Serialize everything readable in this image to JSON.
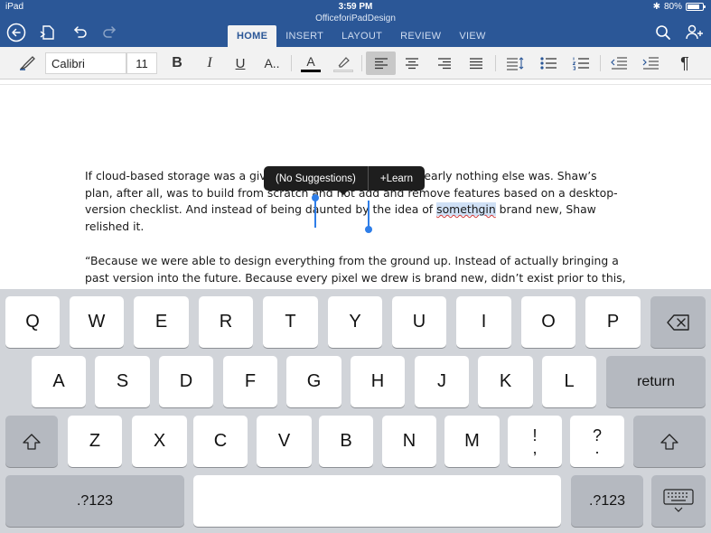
{
  "status_bar": {
    "carrier": "iPad",
    "time": "3:59 PM",
    "battery": "80%",
    "battery_level": 0.8
  },
  "title_bar": {
    "document_title": "OfficeforiPadDesign"
  },
  "header_icons": {
    "back": "back-circle-icon",
    "file": "file-icon",
    "undo": "undo-icon",
    "redo": "redo-icon",
    "search": "search-icon",
    "share": "add-person-icon"
  },
  "tabs": [
    {
      "label": "HOME",
      "active": true
    },
    {
      "label": "INSERT",
      "active": false
    },
    {
      "label": "LAYOUT",
      "active": false
    },
    {
      "label": "REVIEW",
      "active": false
    },
    {
      "label": "VIEW",
      "active": false
    }
  ],
  "ribbon": {
    "font_name": "Calibri",
    "font_size": "11",
    "bold_glyph": "B",
    "italic_glyph": "I",
    "underline_glyph": "U",
    "more_font_glyph": "A..",
    "font_color_glyph": "A",
    "paragraph_mark": "¶",
    "font_color": "#000000",
    "selected_alignment": "left"
  },
  "document": {
    "paragraph1": {
      "before": "If cloud-based storage was a given in this new Office, then nearly nothing else was. Shaw’s plan, after all, was to build from scratch and not add and remove features based on a desktop-version checklist. And instead of being daunted by the idea of ",
      "misspelled": "somethgin",
      "after": " brand new, Shaw relished it."
    },
    "paragraph2": "“Because we were able to design everything from the ground up. Instead of actually bringing a past version into the future. Because every pixel we drew is brand new, didn’t exist prior to this, we were"
  },
  "spell_popup": {
    "no_suggestions": "(No Suggestions)",
    "learn": "+Learn"
  },
  "keyboard": {
    "row1": [
      "Q",
      "W",
      "E",
      "R",
      "T",
      "Y",
      "U",
      "I",
      "O",
      "P"
    ],
    "row2": [
      "A",
      "S",
      "D",
      "F",
      "G",
      "H",
      "J",
      "K",
      "L"
    ],
    "row3": [
      "Z",
      "X",
      "C",
      "V",
      "B",
      "N",
      "M"
    ],
    "punct1_top": "!",
    "punct1_bottom": ",",
    "punct2_top": "?",
    "punct2_bottom": ".",
    "return_label": "return",
    "numbers_label": ".?123",
    "numbers_label_right": ".?123"
  },
  "colors": {
    "accent": "#2b5797",
    "ribbon_bg": "#f2f2f2",
    "keyboard_bg": "#d1d4d9",
    "selection_handle": "#2f7ee8",
    "spell_underline": "#d23c3c"
  }
}
